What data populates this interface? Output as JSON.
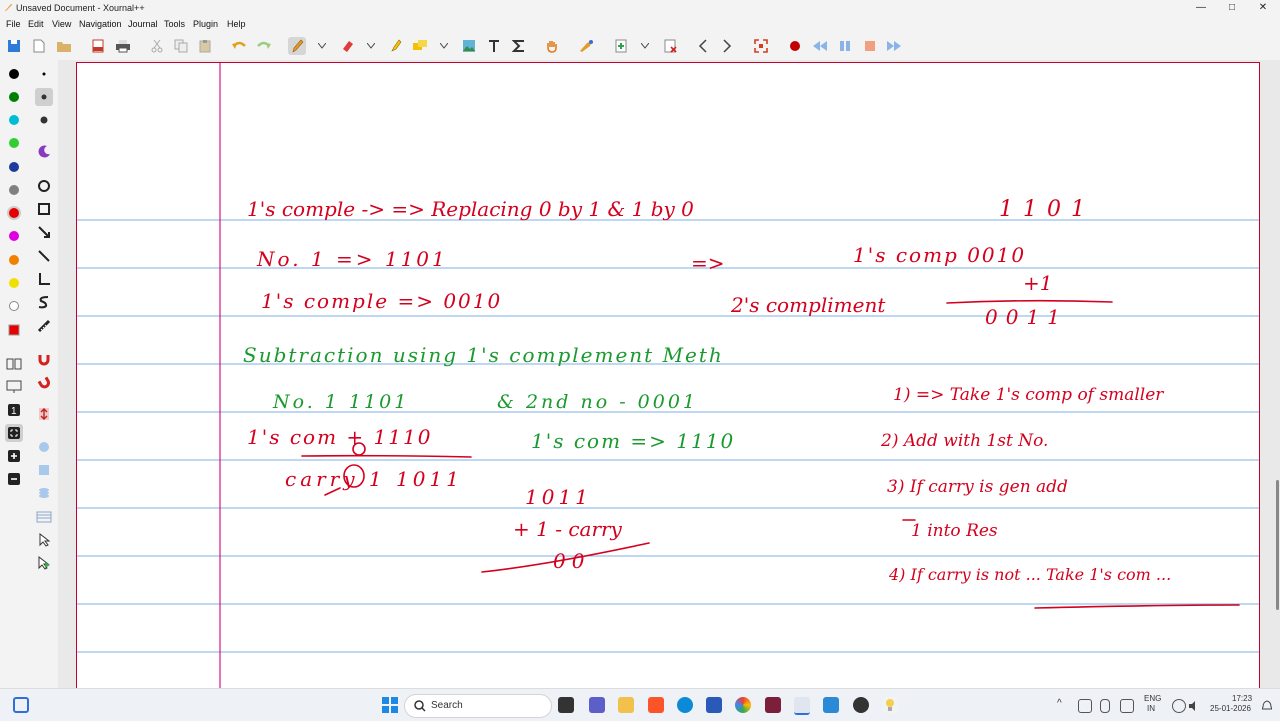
{
  "window": {
    "title": "Unsaved Document - Xournal++",
    "controls": {
      "minimize": "—",
      "maximize": "□",
      "close": "✕"
    }
  },
  "menu": [
    "File",
    "Edit",
    "View",
    "Navigation",
    "Journal",
    "Tools",
    "Plugin",
    "Help"
  ],
  "colors": {
    "accent_toolbar_pen": "#e59b2a",
    "page_margin": "#d4188c",
    "ruled_line": "#7fb2e5",
    "ink_red": "#d4001e",
    "ink_green": "#1a9a2e",
    "page_border": "#c4002c"
  },
  "palette": [
    "#000000",
    "#008000",
    "#00bcd4",
    "#32cd32",
    "#1e3a9a",
    "#808080",
    "#e60000",
    "#e000e0",
    "#f08000",
    "#f0e000",
    "#ffffff",
    "#e60000"
  ],
  "toolbar_icons": [
    "save-icon",
    "new-icon",
    "open-icon",
    "export-pdf-icon",
    "print-icon",
    "cut-icon",
    "copy-icon",
    "paste-icon",
    "undo-icon",
    "redo-icon",
    "pen-icon",
    "eraser-icon",
    "highlighter-icon",
    "select-region-icon",
    "image-icon",
    "text-icon",
    "latex-icon",
    "hand-icon",
    "spline-icon",
    "add-page-icon",
    "delete-page-icon",
    "previous-page-icon",
    "next-page-icon",
    "fullscreen-icon",
    "record-icon",
    "rewind-icon",
    "pause-icon",
    "stop-icon",
    "fast-forward-icon"
  ],
  "notes": {
    "line1": [
      "1's comple -> => Replacing 0 by 1 & 1 by 0",
      "1101"
    ],
    "line2": [
      "No. 1 => 1101",
      "=>",
      "1's comp 0010"
    ],
    "line3": [
      "1's comple => 0010",
      "2's compliment",
      "+1",
      "0011"
    ],
    "line4_green": "Subtraction using 1's complement Meth",
    "line5": [
      "No. 1 1101",
      "& 2nd no - 0001"
    ],
    "line6": [
      "1's com + 1110",
      "1's com => 1110"
    ],
    "line7": [
      "carry 1 1011",
      "1011"
    ],
    "line8": [
      "+ 1 - carry",
      "00"
    ],
    "steps": [
      "1) => Take 1's comp of smaller",
      "2) Add with 1st No.",
      "3) If carry is gen add",
      "1 into Res",
      "4) If carry is not ... Take 1's com ..."
    ]
  },
  "taskbar": {
    "search_placeholder": "Search",
    "lang_top": "ENG",
    "lang_bottom": "IN",
    "time": "17:23",
    "date": "25-01-2026"
  }
}
